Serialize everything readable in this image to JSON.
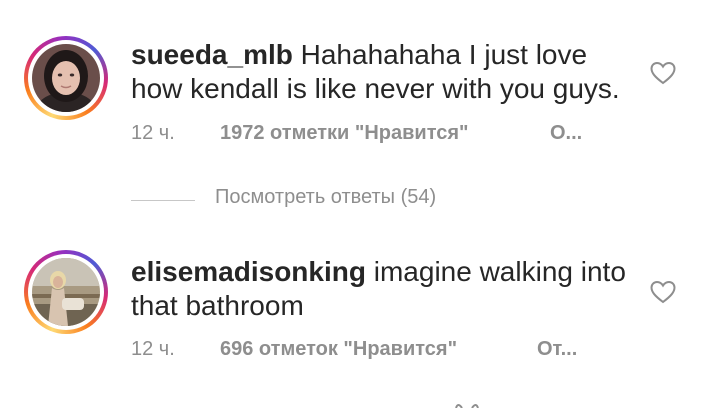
{
  "comments": [
    {
      "username": "sueeda_mlb",
      "text": "Hahahahaha I just love how kendall is like never with you guys.",
      "time": "12 ч.",
      "likes": "1972 отметки \"Нравится\"",
      "reply": "О...",
      "avatar_icon": "user-avatar-photo",
      "like_icon": "heart-outline-icon"
    },
    {
      "username": "elisemadisonking",
      "text": "imagine walking into that bathroom",
      "time": "12 ч.",
      "likes": "696 отметок \"Нравится\"",
      "reply": "От...",
      "avatar_icon": "user-avatar-photo",
      "like_icon": "heart-outline-icon"
    }
  ],
  "view_replies": "Посмотреть ответы (54)",
  "colors": {
    "text": "#262626",
    "secondary": "#8e8e8e",
    "divider": "#c7c7c7",
    "story_ring": [
      "#feda75",
      "#fa7e1e",
      "#d62976",
      "#962fbf",
      "#4f5bd5"
    ]
  }
}
